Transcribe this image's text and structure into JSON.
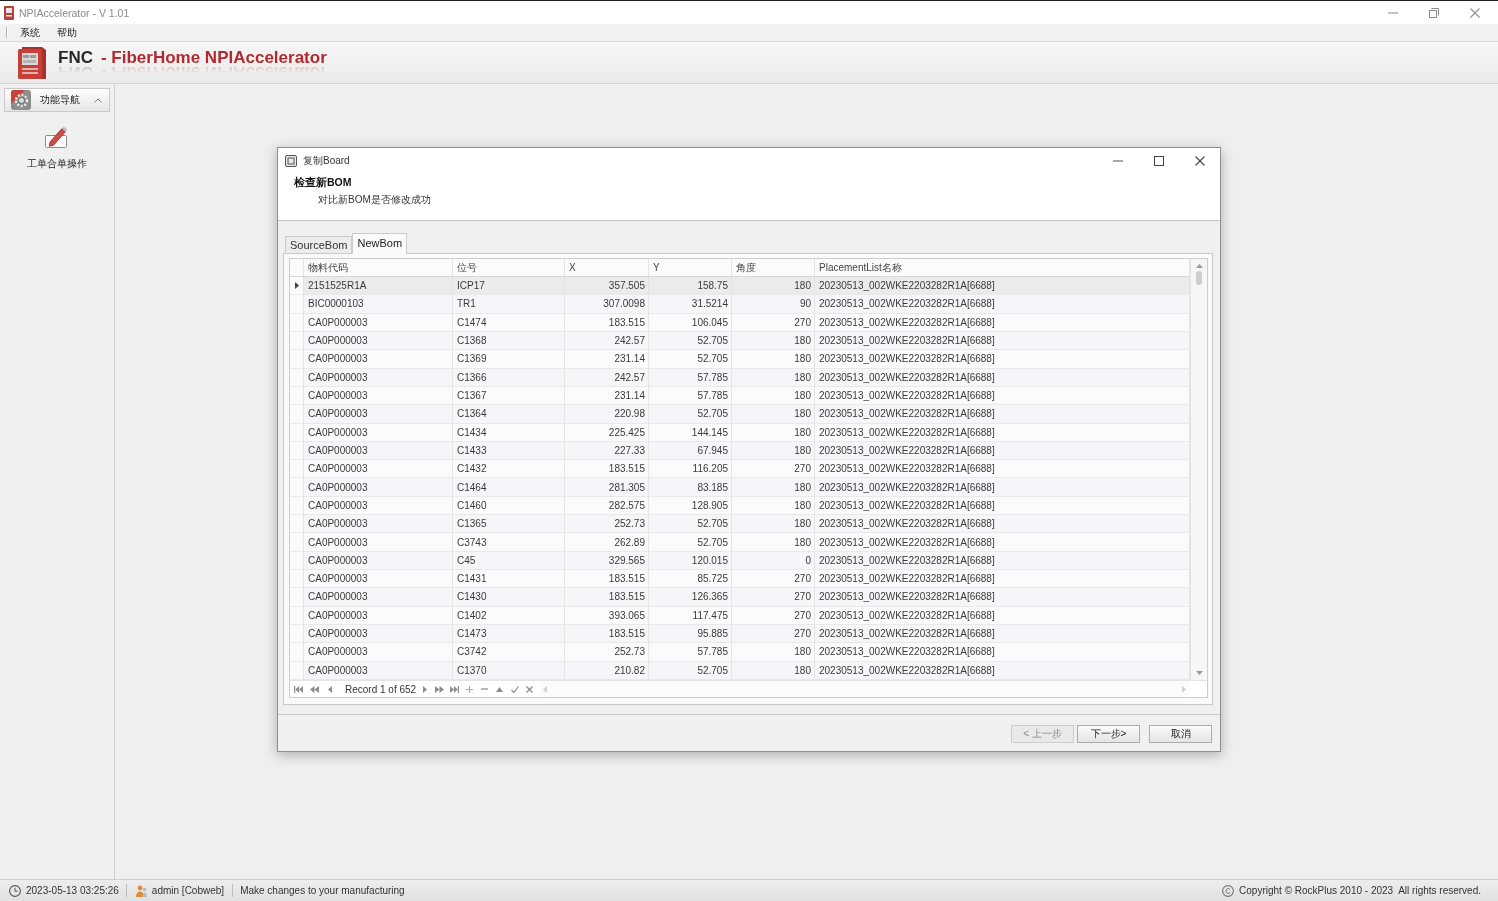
{
  "window": {
    "title": "NPIAccelerator - V 1.01"
  },
  "menu": [
    "系统",
    "帮助"
  ],
  "banner": {
    "code": "FNC",
    "name": "- FiberHome NPIAccelerator"
  },
  "sidebar": {
    "groups": [
      {
        "label": "功能导航",
        "expanded": true,
        "items": [
          {
            "label": "工单合单操作"
          }
        ]
      }
    ]
  },
  "dialog": {
    "title": "复制Board",
    "heading": "检查新BOM",
    "subheading": "对比新BOM是否修改成功",
    "tabs": [
      {
        "label": "SourceBom",
        "selected": false
      },
      {
        "label": "NewBom",
        "selected": true
      }
    ],
    "grid": {
      "columns": [
        {
          "label": "物料代码",
          "kind": "text"
        },
        {
          "label": "位号",
          "kind": "text"
        },
        {
          "label": "X",
          "kind": "number"
        },
        {
          "label": "Y",
          "kind": "number"
        },
        {
          "label": "角度",
          "kind": "number"
        },
        {
          "label": "PlacementList名称",
          "kind": "text"
        }
      ],
      "rows": [
        {
          "selected": true,
          "cells": [
            "2151525R1A",
            "ICP17",
            "357.505",
            "158.75",
            "180",
            "20230513_002WKE2203282R1A[6688]"
          ]
        },
        {
          "selected": false,
          "cells": [
            "BIC0000103",
            "TR1",
            "307.0098",
            "31.5214",
            "90",
            "20230513_002WKE2203282R1A[6688]"
          ]
        },
        {
          "selected": false,
          "cells": [
            "CA0P000003",
            "C1474",
            "183.515",
            "106.045",
            "270",
            "20230513_002WKE2203282R1A[6688]"
          ]
        },
        {
          "selected": false,
          "cells": [
            "CA0P000003",
            "C1368",
            "242.57",
            "52.705",
            "180",
            "20230513_002WKE2203282R1A[6688]"
          ]
        },
        {
          "selected": false,
          "cells": [
            "CA0P000003",
            "C1369",
            "231.14",
            "52.705",
            "180",
            "20230513_002WKE2203282R1A[6688]"
          ]
        },
        {
          "selected": false,
          "cells": [
            "CA0P000003",
            "C1366",
            "242.57",
            "57.785",
            "180",
            "20230513_002WKE2203282R1A[6688]"
          ]
        },
        {
          "selected": false,
          "cells": [
            "CA0P000003",
            "C1367",
            "231.14",
            "57.785",
            "180",
            "20230513_002WKE2203282R1A[6688]"
          ]
        },
        {
          "selected": false,
          "cells": [
            "CA0P000003",
            "C1364",
            "220.98",
            "52.705",
            "180",
            "20230513_002WKE2203282R1A[6688]"
          ]
        },
        {
          "selected": false,
          "cells": [
            "CA0P000003",
            "C1434",
            "225.425",
            "144.145",
            "180",
            "20230513_002WKE2203282R1A[6688]"
          ]
        },
        {
          "selected": false,
          "cells": [
            "CA0P000003",
            "C1433",
            "227.33",
            "67.945",
            "180",
            "20230513_002WKE2203282R1A[6688]"
          ]
        },
        {
          "selected": false,
          "cells": [
            "CA0P000003",
            "C1432",
            "183.515",
            "116.205",
            "270",
            "20230513_002WKE2203282R1A[6688]"
          ]
        },
        {
          "selected": false,
          "cells": [
            "CA0P000003",
            "C1464",
            "281.305",
            "83.185",
            "180",
            "20230513_002WKE2203282R1A[6688]"
          ]
        },
        {
          "selected": false,
          "cells": [
            "CA0P000003",
            "C1460",
            "282.575",
            "128.905",
            "180",
            "20230513_002WKE2203282R1A[6688]"
          ]
        },
        {
          "selected": false,
          "cells": [
            "CA0P000003",
            "C1365",
            "252.73",
            "52.705",
            "180",
            "20230513_002WKE2203282R1A[6688]"
          ]
        },
        {
          "selected": false,
          "cells": [
            "CA0P000003",
            "C3743",
            "262.89",
            "52.705",
            "180",
            "20230513_002WKE2203282R1A[6688]"
          ]
        },
        {
          "selected": false,
          "cells": [
            "CA0P000003",
            "C45",
            "329.565",
            "120.015",
            "0",
            "20230513_002WKE2203282R1A[6688]"
          ]
        },
        {
          "selected": false,
          "cells": [
            "CA0P000003",
            "C1431",
            "183.515",
            "85.725",
            "270",
            "20230513_002WKE2203282R1A[6688]"
          ]
        },
        {
          "selected": false,
          "cells": [
            "CA0P000003",
            "C1430",
            "183.515",
            "126.365",
            "270",
            "20230513_002WKE2203282R1A[6688]"
          ]
        },
        {
          "selected": false,
          "cells": [
            "CA0P000003",
            "C1402",
            "393.065",
            "117.475",
            "270",
            "20230513_002WKE2203282R1A[6688]"
          ]
        },
        {
          "selected": false,
          "cells": [
            "CA0P000003",
            "C1473",
            "183.515",
            "95.885",
            "270",
            "20230513_002WKE2203282R1A[6688]"
          ]
        },
        {
          "selected": false,
          "cells": [
            "CA0P000003",
            "C3742",
            "252.73",
            "57.785",
            "180",
            "20230513_002WKE2203282R1A[6688]"
          ]
        },
        {
          "selected": false,
          "cells": [
            "CA0P000003",
            "C1370",
            "210.82",
            "52.705",
            "180",
            "20230513_002WKE2203282R1A[6688]"
          ]
        }
      ],
      "navigator": {
        "record": "Record 1 of 652"
      }
    },
    "buttons": [
      {
        "label": "< 上一步",
        "disabled": true
      },
      {
        "label": "下一步>",
        "disabled": false
      },
      {
        "label": "取消",
        "disabled": false
      }
    ]
  },
  "status_bar": {
    "time": "2023-05-13 03:25:26",
    "user": "admin [Cobweb]",
    "message": "Make changes to your manufacturing",
    "copyright": "Copyright © RockPlus 2010 - 2023  All rights reserved."
  }
}
